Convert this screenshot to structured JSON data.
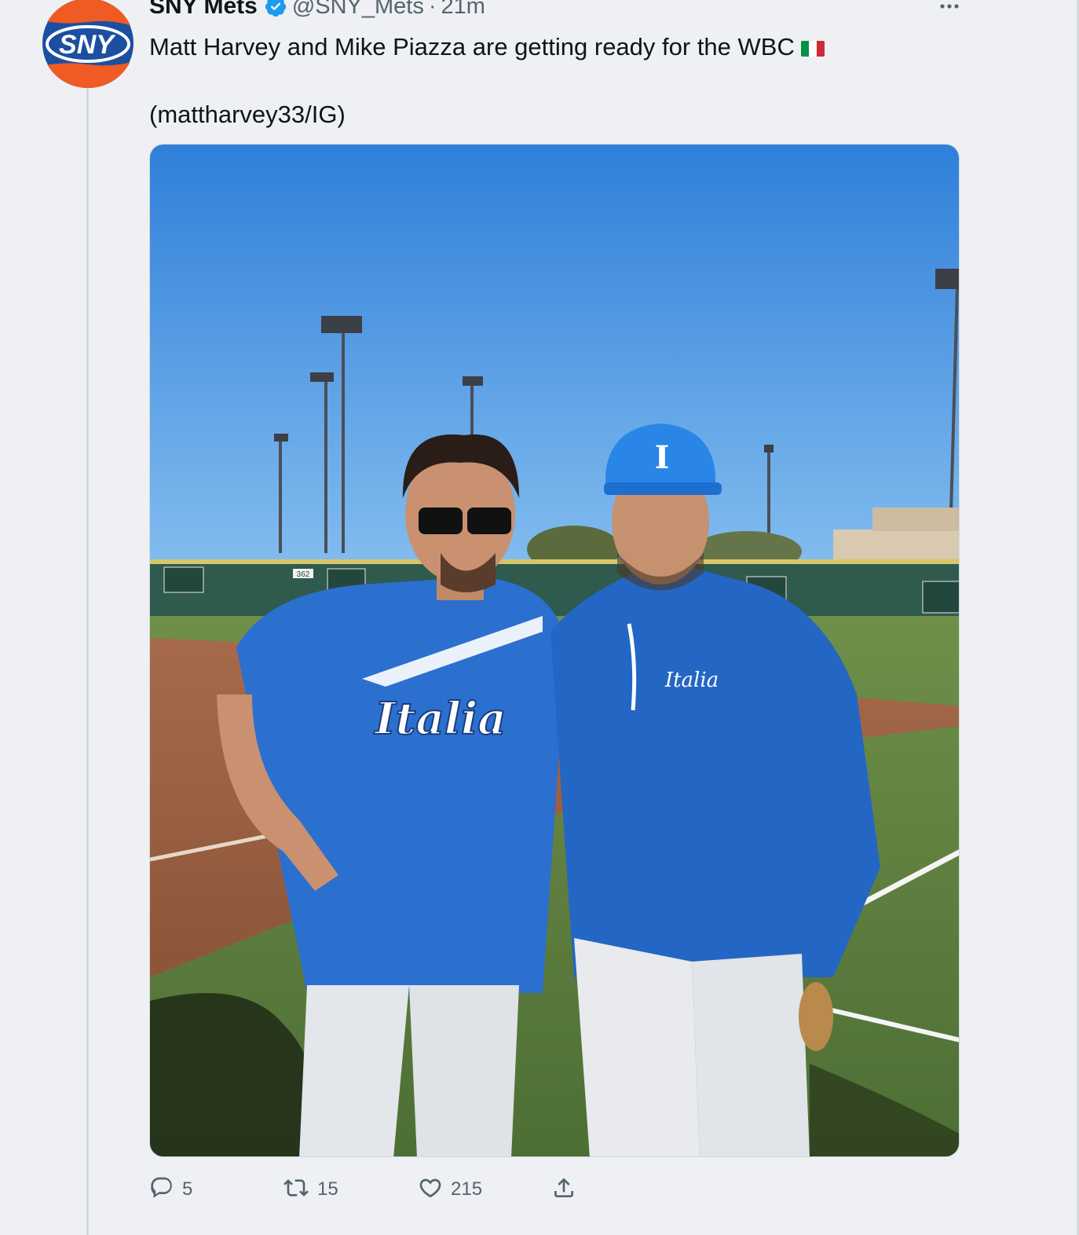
{
  "tweet": {
    "display_name": "SNY Mets",
    "handle": "@SNY_Mets",
    "separator": "·",
    "time": "21m",
    "text": "Matt Harvey and Mike Piazza are getting ready for the WBC",
    "flag_icon": "italy-flag-icon",
    "credit": "(mattharvey33/IG)",
    "avatar_label": "SNY",
    "colors": {
      "verified": "#1d9bf0",
      "avatar_blue": "#1c4fa0",
      "avatar_orange": "#f05a23",
      "flag_green": "#009246",
      "flag_white": "#ffffff",
      "flag_red": "#ce2b37"
    }
  },
  "photo": {
    "scoreboard_number": "362"
  },
  "actions": [
    {
      "name": "reply",
      "icon": "reply-icon",
      "count": "5"
    },
    {
      "name": "retweet",
      "icon": "retweet-icon",
      "count": "15"
    },
    {
      "name": "like",
      "icon": "heart-icon",
      "count": "215"
    },
    {
      "name": "share",
      "icon": "share-icon",
      "count": ""
    }
  ]
}
